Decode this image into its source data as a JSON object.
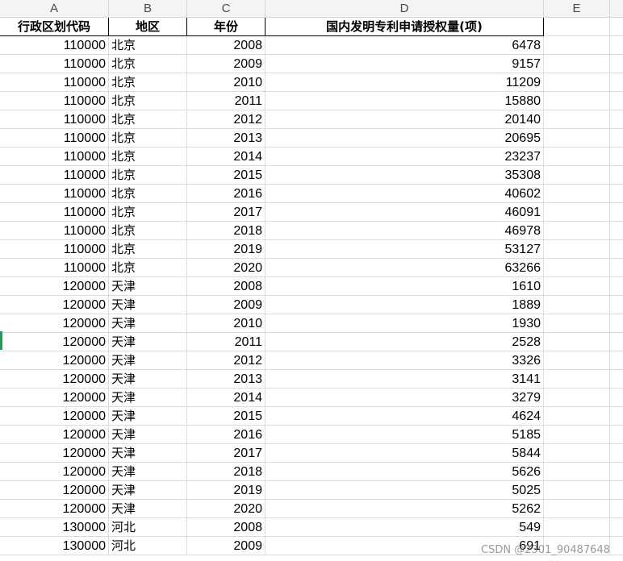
{
  "column_headers": [
    "A",
    "B",
    "C",
    "D",
    "E"
  ],
  "table_headers": [
    "行政区划代码",
    "地区",
    "年份",
    "国内发明专利申请授权量(项)"
  ],
  "rows": [
    [
      "110000",
      "北京",
      "2008",
      "6478"
    ],
    [
      "110000",
      "北京",
      "2009",
      "9157"
    ],
    [
      "110000",
      "北京",
      "2010",
      "11209"
    ],
    [
      "110000",
      "北京",
      "2011",
      "15880"
    ],
    [
      "110000",
      "北京",
      "2012",
      "20140"
    ],
    [
      "110000",
      "北京",
      "2013",
      "20695"
    ],
    [
      "110000",
      "北京",
      "2014",
      "23237"
    ],
    [
      "110000",
      "北京",
      "2015",
      "35308"
    ],
    [
      "110000",
      "北京",
      "2016",
      "40602"
    ],
    [
      "110000",
      "北京",
      "2017",
      "46091"
    ],
    [
      "110000",
      "北京",
      "2018",
      "46978"
    ],
    [
      "110000",
      "北京",
      "2019",
      "53127"
    ],
    [
      "110000",
      "北京",
      "2020",
      "63266"
    ],
    [
      "120000",
      "天津",
      "2008",
      "1610"
    ],
    [
      "120000",
      "天津",
      "2009",
      "1889"
    ],
    [
      "120000",
      "天津",
      "2010",
      "1930"
    ],
    [
      "120000",
      "天津",
      "2011",
      "2528"
    ],
    [
      "120000",
      "天津",
      "2012",
      "3326"
    ],
    [
      "120000",
      "天津",
      "2013",
      "3141"
    ],
    [
      "120000",
      "天津",
      "2014",
      "3279"
    ],
    [
      "120000",
      "天津",
      "2015",
      "4624"
    ],
    [
      "120000",
      "天津",
      "2016",
      "5185"
    ],
    [
      "120000",
      "天津",
      "2017",
      "5844"
    ],
    [
      "120000",
      "天津",
      "2018",
      "5626"
    ],
    [
      "120000",
      "天津",
      "2019",
      "5025"
    ],
    [
      "120000",
      "天津",
      "2020",
      "5262"
    ],
    [
      "130000",
      "河北",
      "2008",
      "549"
    ],
    [
      "130000",
      "河北",
      "2009",
      "691"
    ]
  ],
  "watermark": "CSDN @2301_90487648",
  "colors": {
    "header_bg": "#f4f4f4",
    "grid_line": "#dcdcdc",
    "active_marker": "#1f9d55"
  }
}
